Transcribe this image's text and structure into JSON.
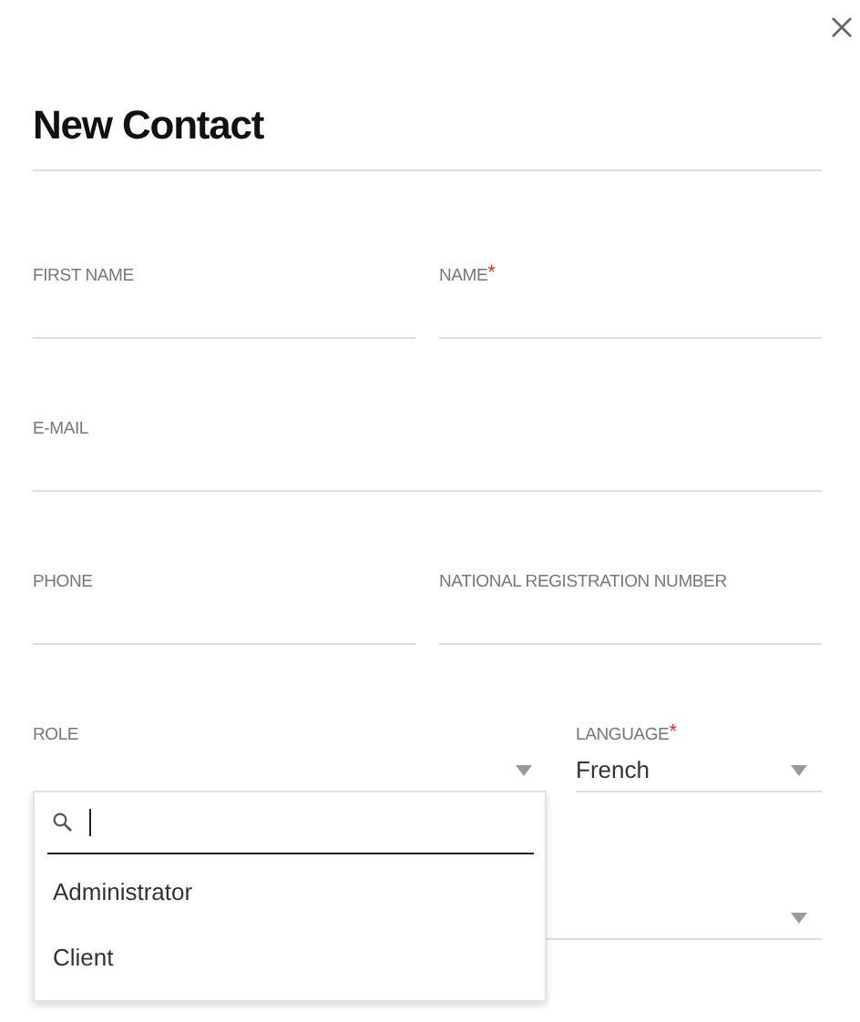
{
  "title": "New Contact",
  "rows": [
    [
      {
        "kind": "text",
        "label": "FIRST NAME"
      },
      {
        "kind": "text",
        "label": "NAME",
        "required_mark": "*"
      }
    ],
    [
      {
        "kind": "text",
        "label": "E-MAIL"
      }
    ],
    [
      {
        "kind": "text",
        "label": "PHONE"
      },
      {
        "kind": "text",
        "label": "NATIONAL REGISTRATION NUMBER"
      }
    ],
    [
      {
        "kind": "select",
        "label": "ROLE"
      },
      {
        "kind": "select",
        "label": "LANGUAGE",
        "required_mark": "*",
        "value": "French"
      }
    ],
    [
      {
        "kind": "select"
      }
    ]
  ],
  "dropdown": {
    "options": [
      {
        "label": "Administrator",
        "selected": false
      },
      {
        "label": "Client",
        "selected": false
      }
    ]
  }
}
